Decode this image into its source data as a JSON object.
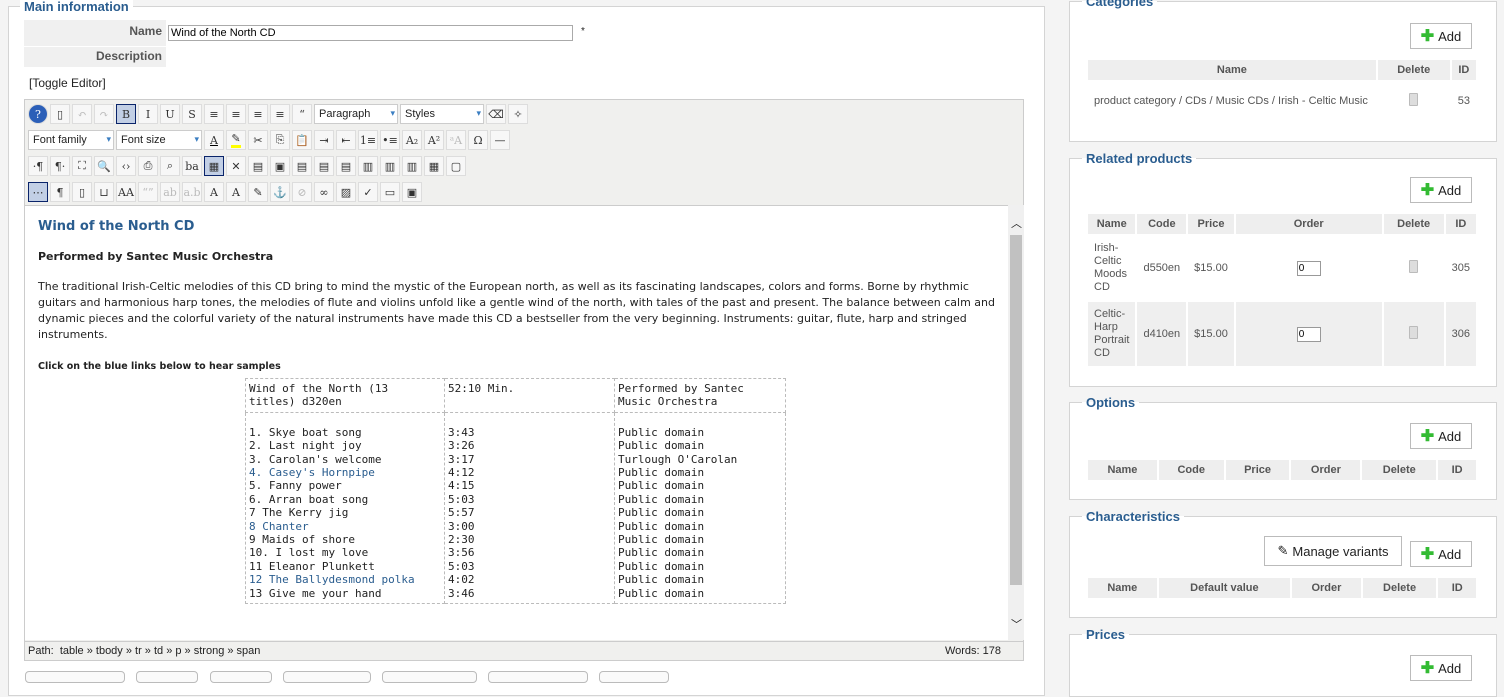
{
  "main": {
    "legend": "Main information",
    "name_label": "Name",
    "name_value": "Wind of the North CD",
    "required": "*",
    "description_label": "Description",
    "toggle_editor": "[Toggle Editor]"
  },
  "editor": {
    "format_select": "Paragraph",
    "styles_select": "Styles",
    "font_family": "Font family",
    "font_size": "Font size",
    "path_label": "Path:",
    "path": "table » tbody » tr » td » p » strong » span",
    "words": "Words: 178",
    "heading": "Wind of the North CD",
    "performed": "Performed by Santec Music Orchestra",
    "body": "The traditional Irish-Celtic melodies of this CD bring to mind the mystic of the European north, as well as its fascinating landscapes, colors and forms. Borne by rhythmic guitars and harmonious harp tones, the melodies of flute and violins unfold like a gentle wind of the north, with tales of the past and present. The balance between calm and dynamic pieces and the colorful variety of the natural instruments have made this CD a bestseller from the very beginning. Instruments: guitar, flute, harp and stringed instruments.",
    "click_note": "Click on the blue links below to hear samples",
    "table_head": [
      "Wind of the North (13 titles) d320en",
      "52:10 Min.",
      "Performed by Santec Music Orchestra"
    ],
    "tracks": [
      {
        "title": "1. Skye boat song",
        "time": "3:43",
        "by": "Public domain",
        "link": false
      },
      {
        "title": "2. Last night joy",
        "time": "3:26",
        "by": "Public domain",
        "link": false
      },
      {
        "title": "3. Carolan's welcome",
        "time": "3:17",
        "by": "Turlough O'Carolan",
        "link": false
      },
      {
        "title": "4. Casey's Hornpipe",
        "time": "4:12",
        "by": "Public domain",
        "link": true
      },
      {
        "title": "5. Fanny power",
        "time": "4:15",
        "by": "Public domain",
        "link": false
      },
      {
        "title": "6. Arran boat song",
        "time": "5:03",
        "by": "Public domain",
        "link": false
      },
      {
        "title": "7 The Kerry jig",
        "time": "5:57",
        "by": "Public domain",
        "link": false
      },
      {
        "title": "8 Chanter",
        "time": "3:00",
        "by": "Public domain",
        "link": true
      },
      {
        "title": "9 Maids of shore",
        "time": "2:30",
        "by": "Public domain",
        "link": false
      },
      {
        "title": "10. I lost my love",
        "time": "3:56",
        "by": "Public domain",
        "link": false
      },
      {
        "title": "11 Eleanor Plunkett",
        "time": "5:03",
        "by": "Public domain",
        "link": false
      },
      {
        "title": "12 The Ballydesmond polka",
        "time": "4:02",
        "by": "Public domain",
        "link": true
      },
      {
        "title": "13 Give me your hand",
        "time": "3:46",
        "by": "Public domain",
        "link": false
      }
    ]
  },
  "toolbar": {
    "row1": [
      [
        "help-icon",
        "?"
      ],
      [
        "new-document-icon",
        "▯"
      ],
      [
        "undo-icon",
        "↶"
      ],
      [
        "redo-icon",
        "↷"
      ],
      [
        "bold-icon",
        "B"
      ],
      [
        "italic-icon",
        "I"
      ],
      [
        "underline-icon",
        "U"
      ],
      [
        "strikethrough-icon",
        "S"
      ],
      [
        "justify-full-icon",
        "≡"
      ],
      [
        "align-center-icon",
        "≡"
      ],
      [
        "align-left-icon",
        "≡"
      ],
      [
        "align-right-icon",
        "≡"
      ],
      [
        "blockquote-icon",
        "“"
      ]
    ],
    "row1b": [
      [
        "eraser-icon",
        "⌫"
      ],
      [
        "broom-cleanup-icon",
        "✧"
      ]
    ],
    "row2": [
      [
        "cut-icon",
        "✂"
      ],
      [
        "copy-icon",
        "⎘"
      ],
      [
        "paste-icon",
        "📋"
      ],
      [
        "indent-icon",
        "⇥"
      ],
      [
        "outdent-icon",
        "⇤"
      ],
      [
        "numbered-list-icon",
        "1≡"
      ],
      [
        "bullet-list-icon",
        "•≡"
      ],
      [
        "subscript-icon",
        "A₂"
      ],
      [
        "superscript-icon",
        "A²"
      ],
      [
        "text-direction-icon",
        "ᵃA"
      ],
      [
        "special-char-icon",
        "Ω"
      ],
      [
        "horizontal-rule-icon",
        "—"
      ]
    ],
    "row3": [
      [
        "ltr-icon",
        "·¶"
      ],
      [
        "rtl-icon",
        "¶·"
      ],
      [
        "fullscreen-icon",
        "⛶"
      ],
      [
        "preview-icon",
        "🔍"
      ],
      [
        "html-source-icon",
        "‹›"
      ],
      [
        "print-icon",
        "⎙"
      ],
      [
        "find-icon",
        "⌕"
      ],
      [
        "replace-icon",
        "ba"
      ],
      [
        "table-icon",
        "▦"
      ],
      [
        "delete-table-icon",
        "✕"
      ],
      [
        "row-props-icon",
        "▤"
      ],
      [
        "cell-props-icon",
        "▣"
      ],
      [
        "insert-row-before-icon",
        "▤"
      ],
      [
        "insert-row-after-icon",
        "▤"
      ],
      [
        "delete-row-icon",
        "▤"
      ],
      [
        "insert-col-before-icon",
        "▥"
      ],
      [
        "insert-col-after-icon",
        "▥"
      ],
      [
        "delete-col-icon",
        "▥"
      ],
      [
        "split-cells-icon",
        "▦"
      ],
      [
        "merge-cells-icon",
        "▢"
      ]
    ],
    "row4": [
      [
        "visual-aid-icon",
        "⋯"
      ],
      [
        "show-blocks-icon",
        "¶"
      ],
      [
        "template-icon",
        "▯"
      ],
      [
        "pagebreak-icon",
        "⊔"
      ],
      [
        "styles-icon",
        "AA"
      ],
      [
        "cite-icon",
        "“”"
      ],
      [
        "abbr-icon",
        "ab"
      ],
      [
        "acronym-icon",
        "a.b"
      ],
      [
        "deletion-icon",
        "A"
      ],
      [
        "insertion-icon",
        "A"
      ],
      [
        "attributes-icon",
        "✎"
      ],
      [
        "anchor-icon",
        "⚓"
      ],
      [
        "unlink-icon",
        "⊘"
      ],
      [
        "link-icon",
        "∞"
      ],
      [
        "image-icon",
        "▨"
      ],
      [
        "spellcheck-icon",
        "✓"
      ],
      [
        "layer-icon",
        "▭"
      ],
      [
        "media-icon",
        "▣"
      ]
    ]
  },
  "categories": {
    "legend": "Categories",
    "add": "Add",
    "headers": [
      "Name",
      "Delete",
      "ID"
    ],
    "rows": [
      {
        "path": [
          "product category",
          "CDs",
          "Music CDs",
          "Irish - Celtic Music"
        ],
        "id": "53"
      }
    ]
  },
  "related": {
    "legend": "Related products",
    "add": "Add",
    "headers": [
      "Name",
      "Code",
      "Price",
      "Order",
      "Delete",
      "ID"
    ],
    "rows": [
      {
        "name": "Irish-Celtic Moods CD",
        "code": "d550en",
        "price": "$15.00",
        "order": "0",
        "id": "305"
      },
      {
        "name": "Celtic-Harp Portrait CD",
        "code": "d410en",
        "price": "$15.00",
        "order": "0",
        "id": "306"
      }
    ]
  },
  "options": {
    "legend": "Options",
    "add": "Add",
    "headers": [
      "Name",
      "Code",
      "Price",
      "Order",
      "Delete",
      "ID"
    ]
  },
  "characteristics": {
    "legend": "Characteristics",
    "manage": "Manage variants",
    "add": "Add",
    "headers": [
      "Name",
      "Default value",
      "Order",
      "Delete",
      "ID"
    ]
  },
  "prices": {
    "legend": "Prices",
    "add": "Add"
  }
}
